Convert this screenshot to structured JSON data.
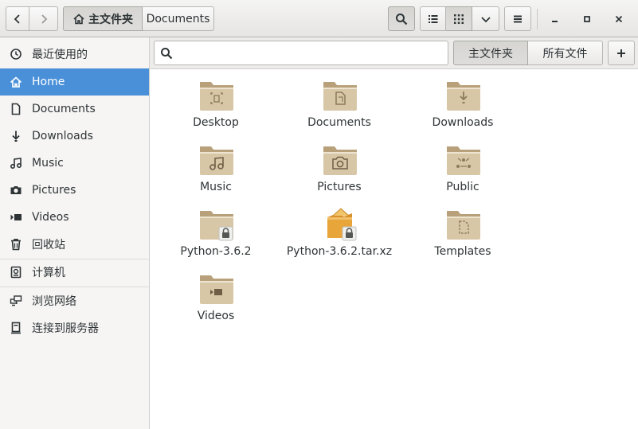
{
  "window": {
    "path": {
      "home_label": "主文件夹",
      "current_label": "Documents"
    }
  },
  "sidebar": {
    "items": [
      {
        "label": "最近使用的",
        "icon": "clock-icon"
      },
      {
        "label": "Home",
        "icon": "home-icon"
      },
      {
        "label": "Documents",
        "icon": "document-icon"
      },
      {
        "label": "Downloads",
        "icon": "download-icon"
      },
      {
        "label": "Music",
        "icon": "music-icon"
      },
      {
        "label": "Pictures",
        "icon": "camera-icon"
      },
      {
        "label": "Videos",
        "icon": "video-icon"
      },
      {
        "label": "回收站",
        "icon": "trash-icon"
      },
      {
        "label": "计算机",
        "icon": "drive-icon"
      },
      {
        "label": "浏览网络",
        "icon": "network-icon"
      },
      {
        "label": "连接到服务器",
        "icon": "server-icon"
      }
    ],
    "active_index": 1
  },
  "search": {
    "value": "",
    "placeholder": "",
    "scope_current": "主文件夹",
    "scope_all": "所有文件"
  },
  "files": [
    {
      "name": "Desktop",
      "icon": "folder-desktop-icon"
    },
    {
      "name": "Documents",
      "icon": "folder-documents-icon"
    },
    {
      "name": "Downloads",
      "icon": "folder-download-icon"
    },
    {
      "name": "Music",
      "icon": "folder-music-icon"
    },
    {
      "name": "Pictures",
      "icon": "folder-pictures-icon"
    },
    {
      "name": "Public",
      "icon": "folder-public-icon"
    },
    {
      "name": "Python-3.6.2",
      "icon": "folder-locked-icon"
    },
    {
      "name": "Python-3.6.2.tar.xz",
      "icon": "archive-locked-icon"
    },
    {
      "name": "Templates",
      "icon": "folder-templates-icon"
    },
    {
      "name": "Videos",
      "icon": "folder-videos-icon"
    }
  ],
  "colors": {
    "accent": "#4a90d9",
    "folder_body": "#d8c7a6",
    "folder_tab": "#b8a17a",
    "archive": "#e8a53a"
  }
}
